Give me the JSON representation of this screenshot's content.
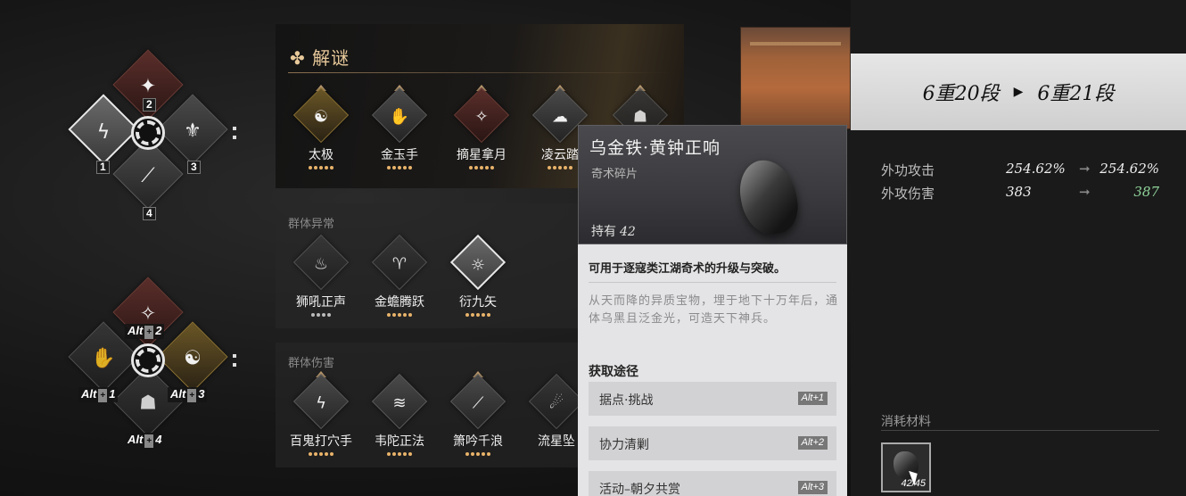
{
  "wheel_top": {
    "keys": [
      "1",
      "2",
      "3",
      "4"
    ]
  },
  "wheel_bottom": {
    "keys": [
      "Alt",
      "2",
      "Alt",
      "1",
      "Alt",
      "3",
      "Alt",
      "4"
    ]
  },
  "puzzle": {
    "title": "解谜",
    "skills": [
      "太极",
      "金玉手",
      "摘星拿月",
      "凌云踏"
    ]
  },
  "group_status": {
    "title": "群体异常",
    "skills": [
      "狮吼正声",
      "金蟾腾跃",
      "衍九矢"
    ]
  },
  "group_damage": {
    "title": "群体伤害",
    "skills": [
      "百鬼打穴手",
      "韦陀正法",
      "箫吟千浪",
      "流星坠"
    ]
  },
  "tooltip": {
    "title": "乌金铁·黄钟正响",
    "subtitle": "奇术碎片",
    "own_label": "持有",
    "own_count": "42",
    "use": "可用于逐寇类江湖奇术的升级与突破。",
    "desc": "从天而降的异质宝物，埋于地下十万年后，通体乌黑且泛金光，可造天下神兵。",
    "get_title": "获取途径",
    "sources": [
      {
        "text": "据点·挑战",
        "key": "Alt+1"
      },
      {
        "text": "协力清剿",
        "key": "Alt+2"
      },
      {
        "text": "活动–朝夕共赏",
        "key": "Alt+3"
      }
    ]
  },
  "rank": {
    "from": "6重20段",
    "to": "6重21段"
  },
  "stats": [
    {
      "label": "外功攻击",
      "before": "254.62%",
      "after": "254.62%"
    },
    {
      "label": "外攻伤害",
      "before": "383",
      "after": "387"
    }
  ],
  "material": {
    "title": "消耗材料",
    "count": "42/45"
  },
  "colors": {
    "accent_gold": "#e8c99a",
    "stat_up": "#8fd39a"
  }
}
